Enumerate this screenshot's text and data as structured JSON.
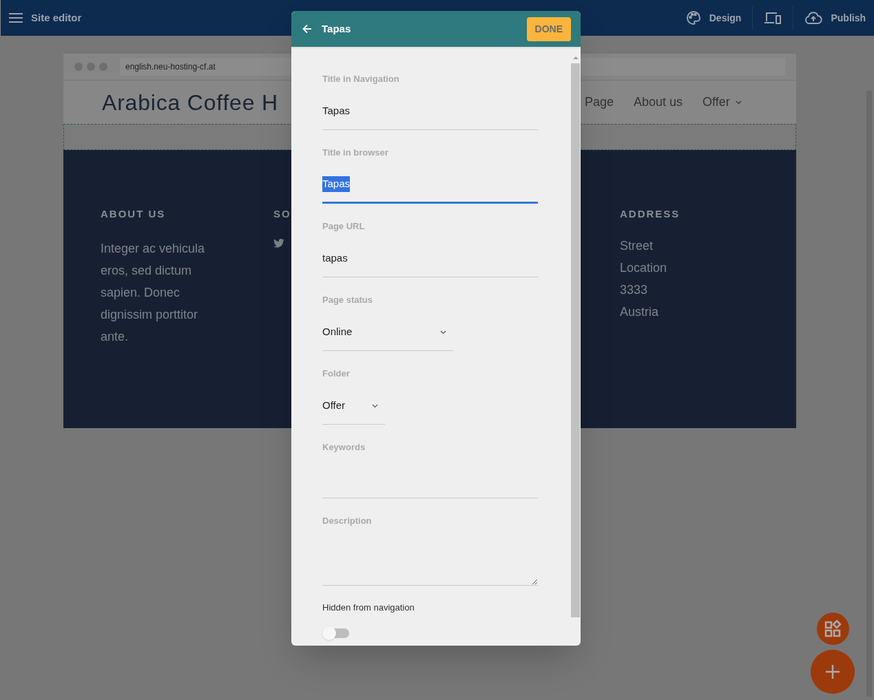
{
  "topbar": {
    "title": "Site editor",
    "actions": [
      {
        "kind": "design",
        "label": "Design"
      },
      {
        "kind": "devices"
      },
      {
        "kind": "publish",
        "label": "Publish"
      }
    ]
  },
  "preview": {
    "url": "english.neu-hosting-cf.at",
    "site_title": "Arabica Coffee H",
    "nav": [
      {
        "label": "Page",
        "dropdown": false
      },
      {
        "label": "About us",
        "dropdown": false
      },
      {
        "label": "Offer",
        "dropdown": true
      }
    ],
    "about": {
      "heading": "ABOUT US",
      "text": "Integer ac vehicula eros, sed dictum sapien. Donec dignissim porttitor ante."
    },
    "social": {
      "heading": "SO"
    },
    "address": {
      "heading": "ADDRESS",
      "lines": [
        "Street",
        "Location",
        "3333",
        "Austria"
      ]
    }
  },
  "dialog": {
    "title": "Tapas",
    "done": "DONE",
    "fields": [
      {
        "kind": "text",
        "label": "Title in Navigation",
        "value": "Tapas",
        "focused": false,
        "text_selected": false
      },
      {
        "kind": "text",
        "label": "Title in browser",
        "value": "Tapas",
        "focused": true,
        "text_selected": true
      },
      {
        "kind": "text",
        "label": "Page URL",
        "value": "tapas",
        "focused": false,
        "text_selected": false
      },
      {
        "kind": "select",
        "label": "Page status",
        "value": "Online",
        "focused": false
      },
      {
        "kind": "select",
        "label": "Folder",
        "value": "Offer",
        "focused": false
      },
      {
        "kind": "text",
        "label": "Keywords",
        "focused": false,
        "text_selected": false
      },
      {
        "kind": "textarea",
        "label": "Description",
        "focused": false
      }
    ],
    "hidden_from_navigation": {
      "label": "Hidden from navigation",
      "on": false
    }
  }
}
